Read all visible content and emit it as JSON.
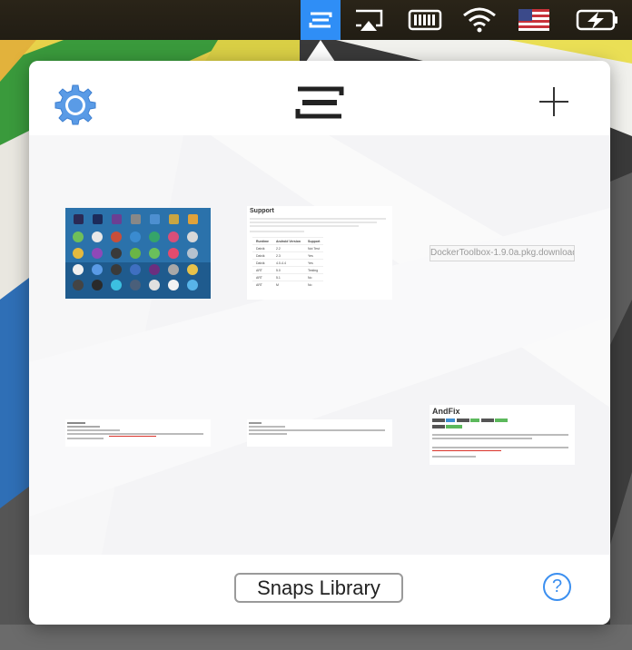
{
  "menubar": {
    "icons": [
      "snaps-icon",
      "airplay-icon",
      "memory-icon",
      "wifi-icon",
      "us-flag-icon",
      "battery-charging-icon"
    ]
  },
  "panel": {
    "header": {
      "settings_icon": "gear-icon",
      "brand_icon": "snaps-logo-icon",
      "add_icon": "plus-icon"
    },
    "snaps": [
      {
        "kind": "screenshot"
      },
      {
        "kind": "document",
        "title": "Support",
        "table_headers": [
          "Runtime",
          "Android Version",
          "Support"
        ],
        "rows": [
          [
            "Dalvik",
            "2.2",
            "Not Test"
          ],
          [
            "Dalvik",
            "2.3",
            "Yes"
          ],
          [
            "Dalvik",
            "4.0-4.4",
            "Yes"
          ],
          [
            "ART",
            "5.0",
            "Testing"
          ],
          [
            "ART",
            "5.1",
            "No"
          ],
          [
            "ART",
            "M",
            "No"
          ]
        ]
      },
      {
        "kind": "file",
        "label": "DockerToolbox-1.9.0a.pkg.download"
      },
      {
        "kind": "note"
      },
      {
        "kind": "note"
      },
      {
        "kind": "document",
        "title": "AndFix"
      }
    ],
    "footer": {
      "library_button": "Snaps Library",
      "help_label": "?"
    }
  },
  "colors": {
    "accent": "#2f8ef6",
    "help_blue": "#3b8ff0",
    "gear_blue": "#5a9be6"
  }
}
